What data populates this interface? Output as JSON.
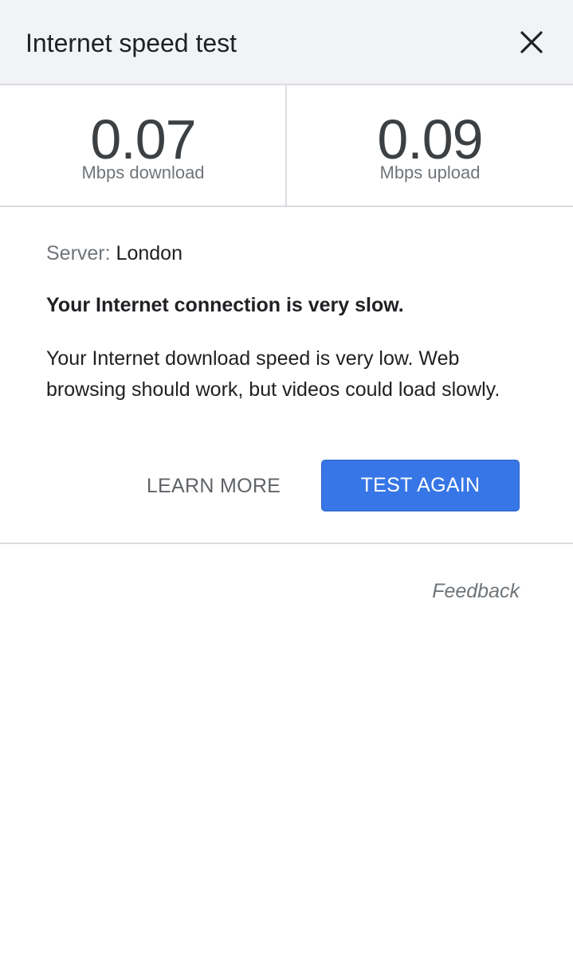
{
  "header": {
    "title": "Internet speed test",
    "close_icon": "close-icon"
  },
  "results": {
    "download": {
      "value": "0.07",
      "label": "Mbps download"
    },
    "upload": {
      "value": "0.09",
      "label": "Mbps upload"
    }
  },
  "details": {
    "server_key": "Server:",
    "server_value": "London",
    "headline": "Your Internet connection is very slow.",
    "description": "Your Internet download speed is very low. Web browsing should work, but videos could load slowly."
  },
  "actions": {
    "learn_more_label": "LEARN MORE",
    "test_again_label": "TEST AGAIN"
  },
  "footer": {
    "feedback_label": "Feedback"
  },
  "colors": {
    "header_bg": "#f1f3f4",
    "primary_button": "#3776e6",
    "divider": "#dadce0",
    "secondary_text": "#70757a"
  }
}
